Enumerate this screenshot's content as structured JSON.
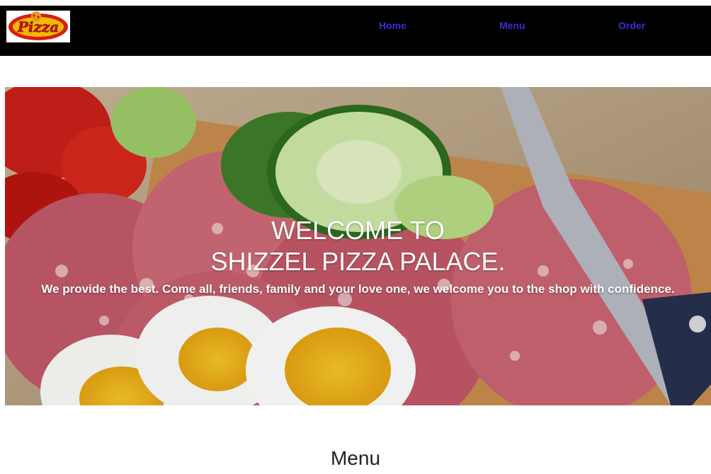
{
  "brand": {
    "logo_text": "Pizza"
  },
  "nav": {
    "home": "Home",
    "menu": "Menu",
    "order": "Order"
  },
  "hero": {
    "title_line1": "WELCOME TO",
    "title_line2": "SHIZZEL PIZZA PALACE.",
    "subtitle": "We provide the best. Come all, friends, family and your love one, we welcome you to the shop with confidence.",
    "image_icon": "food-photo-icon"
  },
  "menu_section": {
    "title": "Menu"
  },
  "colors": {
    "navbar_bg": "#000000",
    "nav_link": "#3b2bd6",
    "page_bg": "#ffffff"
  }
}
